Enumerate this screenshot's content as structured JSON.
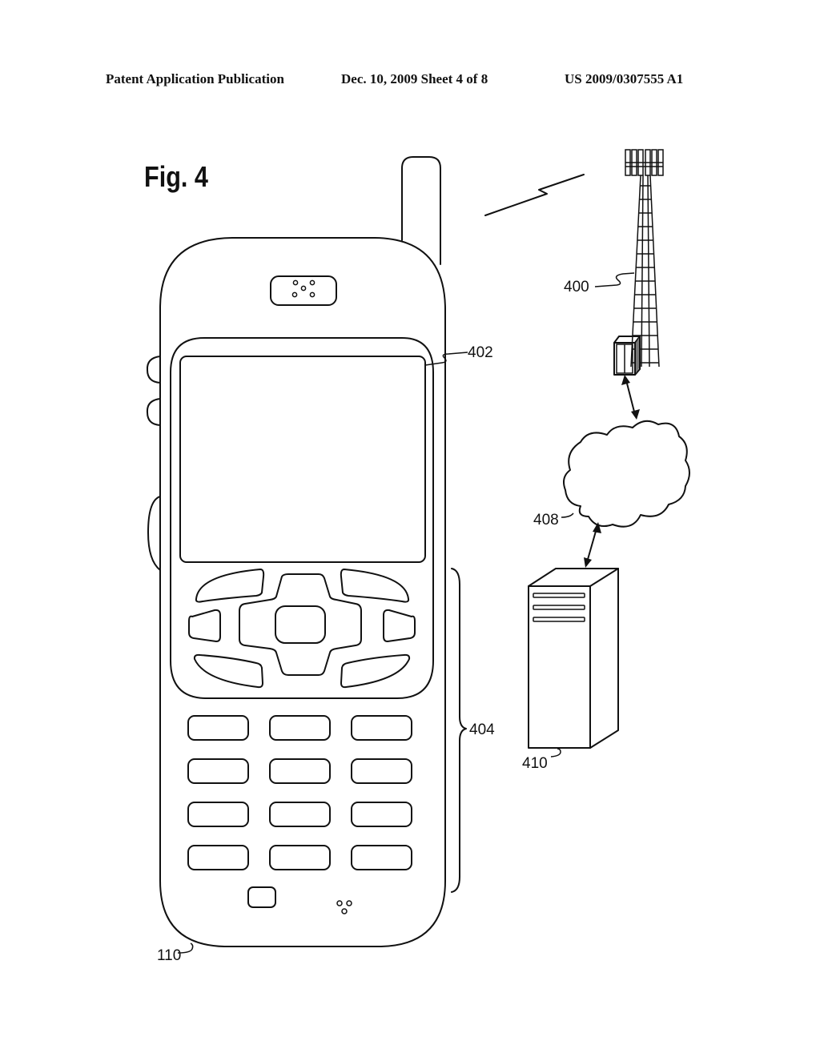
{
  "header": {
    "publication": "Patent Application Publication",
    "date_sheet": "Dec. 10, 2009   Sheet 4 of 8",
    "patent_number": "US 2009/0307555 A1"
  },
  "figure": {
    "title": "Fig. 4"
  },
  "reference_labels": {
    "tower": "400",
    "display": "402",
    "keypad": "404",
    "network": "408",
    "server": "410",
    "phone": "110"
  },
  "components": [
    {
      "ref": "110",
      "name": "mobile-phone"
    },
    {
      "ref": "400",
      "name": "cell-tower"
    },
    {
      "ref": "402",
      "name": "display-screen"
    },
    {
      "ref": "404",
      "name": "keypad"
    },
    {
      "ref": "408",
      "name": "network-cloud"
    },
    {
      "ref": "410",
      "name": "server"
    }
  ],
  "keypad_grid": {
    "rows": 4,
    "cols": 3
  }
}
